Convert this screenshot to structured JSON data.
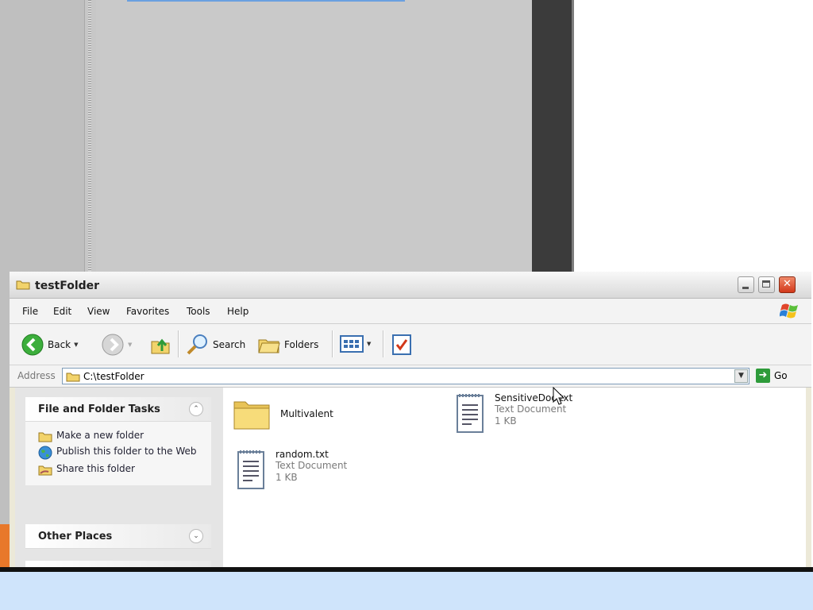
{
  "window": {
    "title": "testFolder",
    "menu": [
      "File",
      "Edit",
      "View",
      "Favorites",
      "Tools",
      "Help"
    ],
    "toolbar": {
      "back_label": "Back",
      "search_label": "Search",
      "folders_label": "Folders"
    },
    "address": {
      "label": "Address",
      "value": "C:\\testFolder",
      "go_label": "Go"
    }
  },
  "tasks": {
    "file_folder": {
      "title": "File and Folder Tasks",
      "items": [
        "Make a new folder",
        "Publish this folder to the Web",
        "Share this folder"
      ]
    },
    "other_places": {
      "title": "Other Places"
    }
  },
  "files": [
    {
      "name": "Multivalent",
      "type": "",
      "size": "",
      "icon": "folder-icon"
    },
    {
      "name": "SensitiveDoc.txt",
      "type": "Text Document",
      "size": "1 KB",
      "icon": "text-document-icon"
    },
    {
      "name": "random.txt",
      "type": "Text Document",
      "size": "1 KB",
      "icon": "text-document-icon"
    }
  ],
  "colors": {
    "taskbar_blue": "#cfe4fb",
    "title_bar": "#e6e6e6",
    "close_button": "#d2381a",
    "go_green": "#2e9b3a"
  }
}
